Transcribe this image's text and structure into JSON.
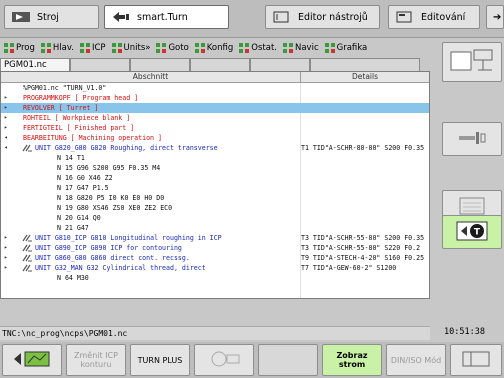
{
  "mode_tabs": [
    {
      "label": "Stroj",
      "icon": "machine-mode-icon",
      "active": false
    },
    {
      "label": "smart.Turn",
      "icon": "programming-mode-icon",
      "active": true
    },
    {
      "label": "Editor nástrojů",
      "icon": "tool-editor-icon",
      "active": false
    },
    {
      "label": "Editování",
      "icon": "editing-icon",
      "active": false
    }
  ],
  "menu": [
    "Prog",
    "Hlav.",
    "ICP",
    "Units»",
    "Goto",
    "Konfig",
    "Ostat.",
    "Navic",
    "Grafika"
  ],
  "doc_tab": "PGM01.nc",
  "table": {
    "col_section": "Abschnitt",
    "col_details": "Details",
    "rows": [
      {
        "marker": "",
        "icon": "",
        "text": "%PGM01.nc  \"TURN_V1.0\"",
        "details": "",
        "color": "dark",
        "indent": 1
      },
      {
        "marker": "▸",
        "icon": "",
        "text": "PROGRAMMKOPF  [ Program head ]",
        "details": "",
        "color": "red",
        "indent": 1
      },
      {
        "marker": "▸",
        "icon": "",
        "text": "REVOLVER  [ Turret ]",
        "details": "",
        "color": "red",
        "indent": 1,
        "selected": true
      },
      {
        "marker": "▸",
        "icon": "",
        "text": "ROHTEIL  [ Workpiece blank ]",
        "details": "",
        "color": "red",
        "indent": 1
      },
      {
        "marker": "▸",
        "icon": "",
        "text": "FERTIGTEIL  [ Finished part ]",
        "details": "",
        "color": "red",
        "indent": 1
      },
      {
        "marker": "◂",
        "icon": "",
        "text": "BEARBEITUNG  [ Machining operation ]",
        "details": "",
        "color": "red",
        "indent": 1
      },
      {
        "marker": "◂",
        "icon": "unit-icon",
        "text": "UNIT G820_G80  G820 Roughing, direct transverse",
        "details": "T1 TID\"A-SCHR-80-80\" S200 F0.35",
        "color": "blue",
        "indent": 2
      },
      {
        "marker": "",
        "icon": "",
        "text": "N  14  T1",
        "details": "",
        "color": "dark",
        "indent": 3
      },
      {
        "marker": "",
        "icon": "",
        "text": "N  15  G96 S200 G95 F0.35 M4",
        "details": "",
        "color": "dark",
        "indent": 3
      },
      {
        "marker": "",
        "icon": "",
        "text": "N  16  G0 X46 Z2",
        "details": "",
        "color": "dark",
        "indent": 3
      },
      {
        "marker": "",
        "icon": "",
        "text": "N  17  G47 P1.5",
        "details": "",
        "color": "dark",
        "indent": 3
      },
      {
        "marker": "",
        "icon": "",
        "text": "N  18  G820 P5 I0 K0 E0 H0 D0",
        "details": "",
        "color": "dark",
        "indent": 3
      },
      {
        "marker": "",
        "icon": "",
        "text": "N  19  G80 XS46 ZS0 XE0 ZE2 EC0",
        "details": "",
        "color": "dark",
        "indent": 3
      },
      {
        "marker": "",
        "icon": "",
        "text": "N  20  G14 Q0",
        "details": "",
        "color": "dark",
        "indent": 3
      },
      {
        "marker": "",
        "icon": "",
        "text": "N  21  G47",
        "details": "",
        "color": "dark",
        "indent": 3
      },
      {
        "marker": "▸",
        "icon": "unit-icon",
        "text": "UNIT G810_ICP  G810 Longitudinal roughing in ICP",
        "details": "T3 TID\"A-SCHR-55-80\" S200 F0.35",
        "color": "blue",
        "indent": 2
      },
      {
        "marker": "▸",
        "icon": "unit-icon",
        "text": "UNIT G890_ICP  G890 ICP for contouring",
        "details": "T3 TID\"A-SCHR-55-80\" S220 F0.2",
        "color": "blue",
        "indent": 2
      },
      {
        "marker": "▸",
        "icon": "unit-icon",
        "text": "UNIT G860_G80  G860 direct cont. recssg.",
        "details": "T9 TID\"A-STECH-4-20\" S160 F0.25",
        "color": "blue",
        "indent": 2
      },
      {
        "marker": "▸",
        "icon": "unit-icon",
        "text": "UNIT G32_MAN  G32 Cylindrical thread, direct",
        "details": "T7 TID\"A-GEW-60-2\" S1200",
        "color": "blue",
        "indent": 2
      },
      {
        "marker": "",
        "icon": "",
        "text": "N  64 M30",
        "details": "",
        "color": "dark",
        "indent": 3
      }
    ]
  },
  "status_path": "TNC:\\nc_prog\\ncps\\PGM01.nc",
  "clock": "10:51:38",
  "right_keys": [
    "machine-axes-icon",
    "tool-insert-icon",
    "drawing-view-icon",
    "tool-turret-icon"
  ],
  "bottom_keys": [
    {
      "label": "",
      "icon": "start-contour-icon"
    },
    {
      "label": "Změnit ICP konturu",
      "icon": "",
      "disabled": true
    },
    {
      "label": "TURN PLUS",
      "icon": "",
      "disabled": false
    },
    {
      "label": "",
      "icon": "simulation-icon",
      "disabled": true
    },
    {
      "label": "Zobraz strom",
      "icon": "",
      "disabled": false,
      "green": true
    },
    {
      "label": "DIN/ISO Mód",
      "icon": "",
      "disabled": true
    },
    {
      "label": "",
      "icon": "window-layout-icon"
    }
  ]
}
